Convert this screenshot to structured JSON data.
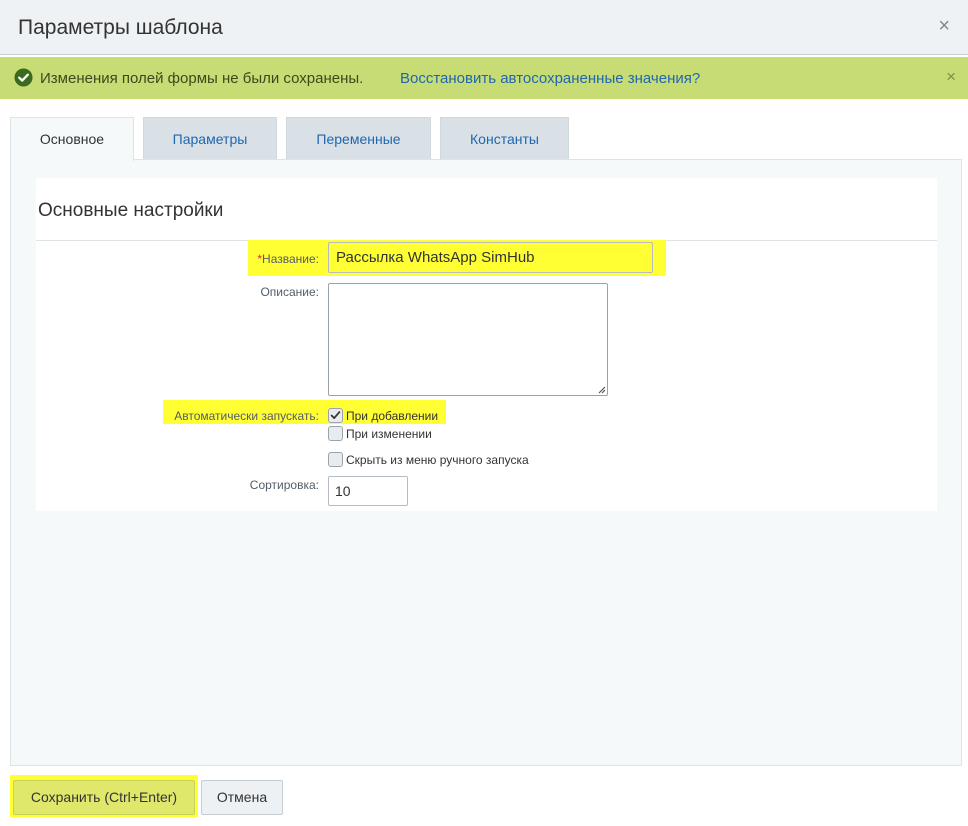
{
  "dialog": {
    "title": "Параметры шаблона",
    "close_symbol": "×"
  },
  "notice": {
    "message": "Изменения полей формы не были сохранены.",
    "restore_link": "Восстановить автосохраненные значения?",
    "close_symbol": "×",
    "background_color": "#c7dc74"
  },
  "tabs": [
    {
      "label": "Основное",
      "active": true
    },
    {
      "label": "Параметры",
      "active": false
    },
    {
      "label": "Переменные",
      "active": false
    },
    {
      "label": "Константы",
      "active": false
    }
  ],
  "section": {
    "title": "Основные настройки"
  },
  "form": {
    "name_required_mark": "*",
    "name_label": "Название:",
    "name_value": "Рассылка WhatsApp SimHub",
    "description_label": "Описание:",
    "description_value": "",
    "autostart_label": "Автоматически запускать:",
    "options": [
      {
        "label": "При добавлении",
        "checked": true
      },
      {
        "label": "При изменении",
        "checked": false
      },
      {
        "label": "Скрыть из меню ручного запуска",
        "checked": false
      }
    ],
    "sort_label": "Сортировка:",
    "sort_value": "10"
  },
  "buttons": {
    "save_label": "Сохранить (Ctrl+Enter)",
    "cancel_label": "Отмена"
  },
  "colors": {
    "highlight": "#ffff33",
    "link": "#2067b0",
    "required": "#e02b2b"
  }
}
